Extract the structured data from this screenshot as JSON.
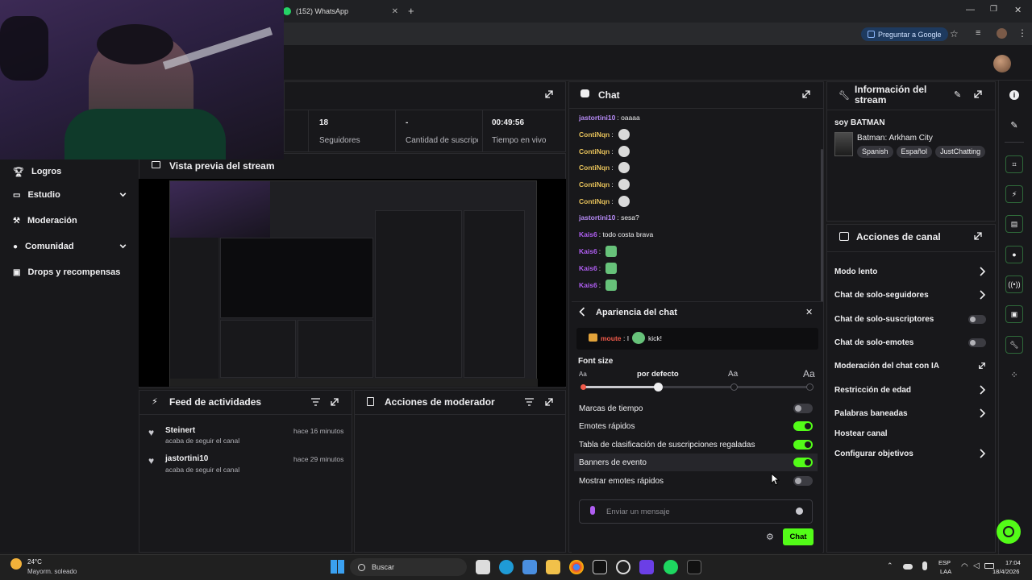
{
  "browser": {
    "tab_title": "(152) WhatsApp",
    "ask_google": "Preguntar a Google"
  },
  "nav": {
    "items": [
      {
        "label": "Logros"
      },
      {
        "label": "Estudio"
      },
      {
        "label": "Moderación"
      },
      {
        "label": "Comunidad"
      },
      {
        "label": "Drops y recompensas"
      }
    ]
  },
  "stats": {
    "followers_value": "18",
    "followers_label": "Seguidores",
    "subs_value": "-",
    "subs_label": "Cantidad de suscripciones",
    "time_value": "00:49:56",
    "time_label": "Tiempo en vivo"
  },
  "preview": {
    "title": "Vista previa del stream"
  },
  "activity": {
    "title": "Feed de actividades",
    "items": [
      {
        "user": "Steinert",
        "action": "acaba de seguir el canal",
        "time": "hace 16 minutos"
      },
      {
        "user": "jastortini10",
        "action": "acaba de seguir el canal",
        "time": "hace 29 minutos"
      }
    ]
  },
  "moderator": {
    "title": "Acciones de moderador"
  },
  "chat": {
    "title": "Chat",
    "messages": [
      {
        "user": "jastortini10",
        "text": ": oaaaa",
        "color": "#b78bf7"
      },
      {
        "user": "ContiNqn",
        "text": ":",
        "color": "#e6c15a"
      },
      {
        "user": "ContiNqn",
        "text": ":",
        "color": "#e6c15a"
      },
      {
        "user": "ContiNqn",
        "text": ":",
        "color": "#e6c15a"
      },
      {
        "user": "ContiNqn",
        "text": ":",
        "color": "#e6c15a"
      },
      {
        "user": "ContiNqn",
        "text": ":",
        "color": "#e6c15a"
      },
      {
        "user": "jastortini10",
        "text": ": sesa?",
        "color": "#b78bf7"
      },
      {
        "user": "Kais6",
        "text": ": todo costa brava",
        "color": "#b05ef2"
      },
      {
        "user": "Kais6",
        "text": ":",
        "color": "#b05ef2"
      },
      {
        "user": "Kais6",
        "text": ":",
        "color": "#b05ef2"
      },
      {
        "user": "Kais6",
        "text": ":",
        "color": "#b05ef2"
      }
    ],
    "appearance_title": "Apariencia del chat",
    "preview_user": "moute",
    "preview_text": ": I",
    "preview_suffix": "kick!",
    "font_size_label": "Font size",
    "font_small": "Aa",
    "font_default": "por defecto",
    "font_medium": "Aa",
    "font_large": "Aa",
    "font_level": 0.33,
    "settings": [
      {
        "label": "Marcas de tiempo",
        "on": false
      },
      {
        "label": "Emotes rápidos",
        "on": true
      },
      {
        "label": "Tabla de clasificación de suscripciones regaladas",
        "on": true
      },
      {
        "label": "Banners de evento",
        "on": true
      },
      {
        "label": "Mostrar emotes rápidos",
        "on": false
      }
    ],
    "input_placeholder": "Enviar un mensaje",
    "send_label": "Chat"
  },
  "stream_info": {
    "title": "Información del stream",
    "stream_title": "soy BATMAN",
    "game": "Batman: Arkham City",
    "tags": [
      "Spanish",
      "Español",
      "JustChatting"
    ]
  },
  "channel_actions": {
    "title": "Acciones de canal",
    "items": [
      {
        "label": "Modo lento",
        "type": "chevron"
      },
      {
        "label": "Chat de solo-seguidores",
        "type": "chevron"
      },
      {
        "label": "Chat de solo-suscriptores",
        "type": "toggle"
      },
      {
        "label": "Chat de solo-emotes",
        "type": "toggle"
      },
      {
        "label": "Moderación del chat con IA",
        "type": "external"
      },
      {
        "label": "Restricción de edad",
        "type": "chevron"
      },
      {
        "label": "Palabras baneadas",
        "type": "chevron"
      },
      {
        "label": "Hostear canal",
        "type": "none"
      },
      {
        "label": "Configurar objetivos",
        "type": "chevron"
      }
    ]
  },
  "taskbar": {
    "temp": "24°C",
    "weather": "Mayorm. soleado",
    "search": "Buscar",
    "lang1": "ESP",
    "lang2": "LAA",
    "time": "17:04",
    "date": "18/4/2026"
  },
  "colors": {
    "accent": "#53fc18",
    "panel": "#18181b",
    "bg": "#0e0e10"
  }
}
